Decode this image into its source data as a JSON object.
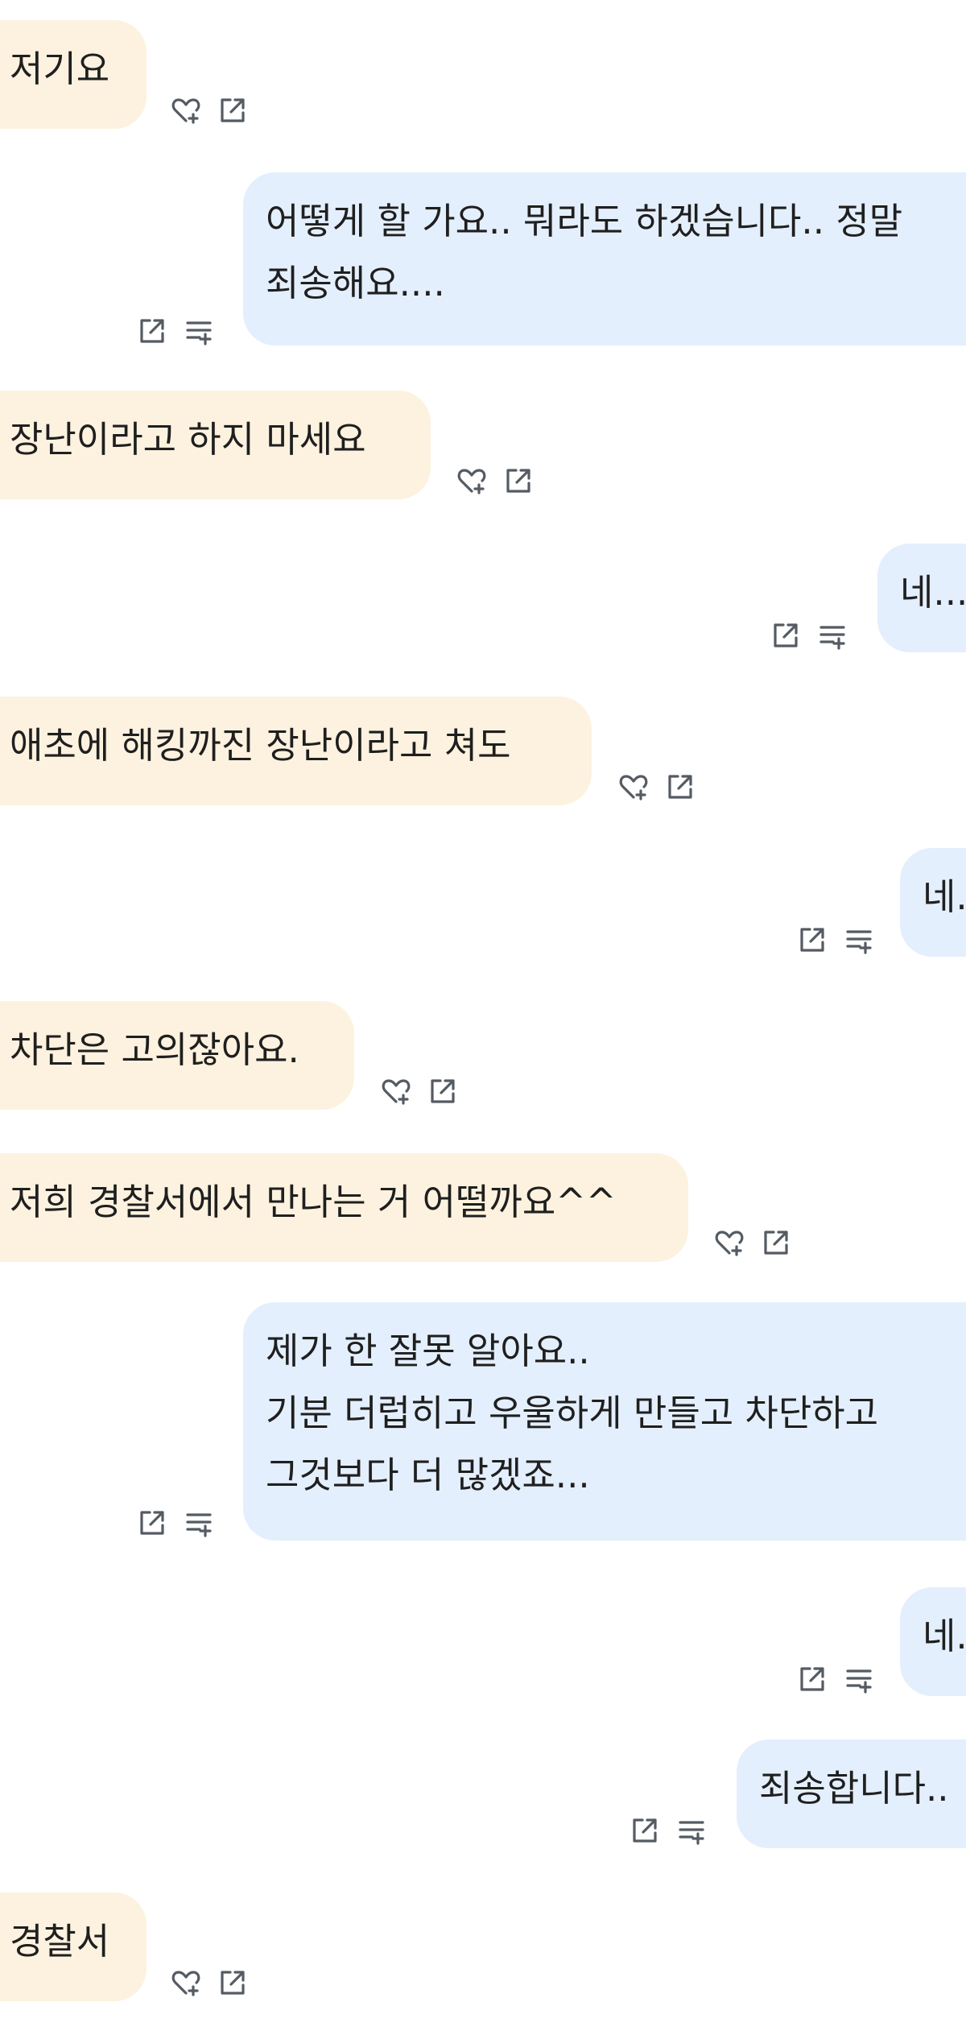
{
  "messages": [
    {
      "sender": "other",
      "lines": [
        "저기요"
      ]
    },
    {
      "sender": "me",
      "lines": [
        "어떻게 할 가요.. 뭐라도 하겠습니다.. 정말",
        "죄송해요...."
      ]
    },
    {
      "sender": "other",
      "lines": [
        "장난이라고 하지 마세요"
      ]
    },
    {
      "sender": "me",
      "lines": [
        "네..."
      ]
    },
    {
      "sender": "other",
      "lines": [
        "애초에 해킹까진 장난이라고 쳐도"
      ]
    },
    {
      "sender": "me",
      "lines": [
        "네..."
      ]
    },
    {
      "sender": "other",
      "lines": [
        "차단은 고의잖아요."
      ]
    },
    {
      "sender": "other",
      "lines": [
        "저희 경찰서에서 만나는 거 어떨까요^^"
      ]
    },
    {
      "sender": "me",
      "lines": [
        "제가 한 잘못 알아요..",
        "기분 더럽히고 우울하게 만들고 차단하고",
        "그것보다 더 많겠죠..."
      ]
    },
    {
      "sender": "me",
      "lines": [
        "네..."
      ]
    },
    {
      "sender": "me",
      "lines": [
        "죄송합니다.."
      ]
    },
    {
      "sender": "other",
      "lines": [
        "경찰서"
      ]
    }
  ],
  "icons": {
    "other_actions": [
      "heart-add-icon",
      "share-icon"
    ],
    "my_actions": [
      "share-icon",
      "continue-icon"
    ]
  },
  "colors": {
    "other_bubble": "#fdf2df",
    "my_bubble": "#e4effd",
    "icon": "#555b63"
  }
}
